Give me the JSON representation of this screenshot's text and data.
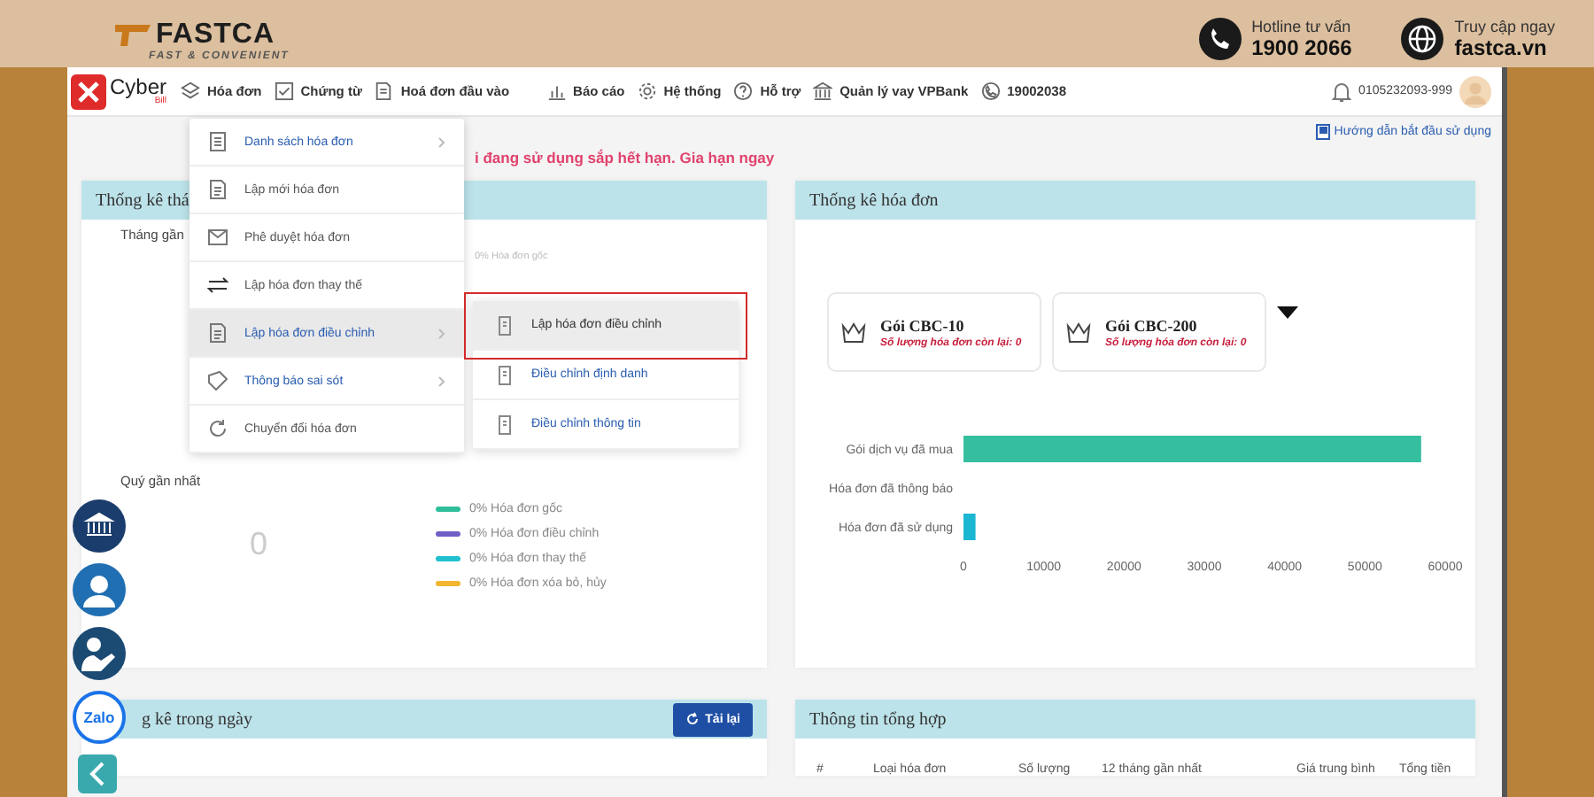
{
  "banner": {
    "logo": "FASTCA",
    "slogan": "FAST & CONVENIENT",
    "contacts": [
      {
        "kind": "phone",
        "label": "Hotline tư vấn",
        "value": "1900 2066"
      },
      {
        "kind": "web",
        "label": "Truy cập ngay",
        "value": "fastca.vn"
      }
    ]
  },
  "app": {
    "logo": {
      "name": "Cyber",
      "sub": "Bill"
    },
    "nav": [
      {
        "label": "Hóa đơn"
      },
      {
        "label": "Chứng từ"
      },
      {
        "label": "Hoá đơn đầu vào"
      },
      {
        "label": "Báo cáo"
      },
      {
        "label": "Hệ thống"
      },
      {
        "label": "Hỗ trợ"
      },
      {
        "label": "Quản lý vay VPBank"
      },
      {
        "label": "19002038"
      }
    ],
    "account": "0105232093-999",
    "notice": "i đang sử dụng sắp hết hạn. Gia hạn ngay",
    "guide_link": "Hướng dẫn bắt đầu sử dụng",
    "left_panel": {
      "title": "Thống kê thá",
      "month_label": "Tháng gần",
      "month_legend": "0% Hóa đơn gốc",
      "quarter_label": "Quý gần nhất",
      "quarter_total": "0",
      "legend": [
        {
          "label": "0% Hóa đơn gốc",
          "color": "#2fbf9a"
        },
        {
          "label": "0% Hóa đơn điều chỉnh",
          "color": "#6f5fc7"
        },
        {
          "label": "0% Hóa đơn thay thế",
          "color": "#20c0cf"
        },
        {
          "label": "0% Hóa đơn xóa bỏ, hủy",
          "color": "#f2b630"
        }
      ]
    },
    "right_panel": {
      "title": "Thống kê hóa đơn",
      "packages": [
        {
          "name": "Gói CBC-10",
          "remaining": "Số lượng hóa đơn còn lại: 0"
        },
        {
          "name": "Gói CBC-200",
          "remaining": "Số lượng hóa đơn còn lại: 0"
        }
      ],
      "chart_data": {
        "type": "bar",
        "orientation": "horizontal",
        "categories": [
          "Gói dịch vụ đã mua",
          "Hóa đơn đã thông báo",
          "Hóa đơn đã sử dụng"
        ],
        "values": [
          57000,
          0,
          1500
        ],
        "xlim": [
          0,
          60000
        ],
        "xticks": [
          0,
          10000,
          20000,
          30000,
          40000,
          50000,
          60000
        ]
      }
    },
    "daily_panel": {
      "title": "g kê trong ngày",
      "reload": "Tải lại"
    },
    "summary_panel": {
      "title": "Thông tin tổng hợp",
      "columns": [
        "#",
        "Loại hóa đơn",
        "Số lượng",
        "12 tháng gần nhất",
        "Giá trung bình",
        "Tổng tiền"
      ]
    },
    "menu": [
      {
        "label": "Danh sách hóa đơn",
        "has_submenu": true,
        "selected": false
      },
      {
        "label": "Lập mới hóa đơn",
        "has_submenu": false,
        "selected": false
      },
      {
        "label": "Phê duyệt hóa đơn",
        "has_submenu": false,
        "selected": false
      },
      {
        "label": "Lập hóa đơn thay thế",
        "has_submenu": false,
        "selected": false
      },
      {
        "label": "Lập hóa đơn điều chỉnh",
        "has_submenu": true,
        "selected": true
      },
      {
        "label": "Thông báo sai sót",
        "has_submenu": true,
        "selected": false
      },
      {
        "label": "Chuyển đổi hóa đơn",
        "has_submenu": false,
        "selected": false
      }
    ],
    "submenu": [
      {
        "label": "Lập hóa đơn điều chỉnh",
        "selected": true,
        "highlighted": true
      },
      {
        "label": "Điều chỉnh định danh",
        "selected": false,
        "highlighted": false
      },
      {
        "label": "Điều chỉnh thông tin",
        "selected": false,
        "highlighted": false
      }
    ]
  },
  "floating_buttons": [
    {
      "kind": "bank"
    },
    {
      "kind": "support"
    },
    {
      "kind": "reader"
    },
    {
      "kind": "zalo",
      "label": "Zalo"
    },
    {
      "kind": "collapse"
    }
  ]
}
